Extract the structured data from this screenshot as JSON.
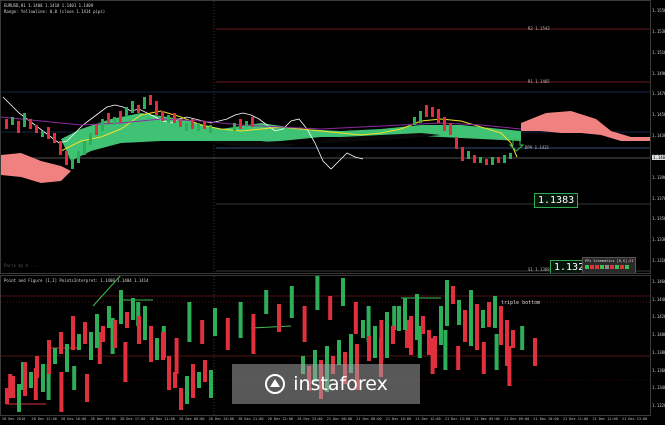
{
  "main": {
    "title": "EURUSD,H1 1.1408 1.1418 1.1401 1.1409",
    "subtitle": "Range: Yellowline: 0.0 (close 1.1414 pips)",
    "pivot_labels": {
      "r2": "R2 1.1543",
      "r1": "R1 1.1465",
      "pp": "DPV 1.1421",
      "s1": "S1 1.1368"
    },
    "price_box_mid": "1.1383",
    "price_box_low": "1.132",
    "current_price": "1.1407",
    "copyright": "Paris by © ...",
    "axis_labels": [
      "1.1550",
      "1.1530",
      "1.1510",
      "1.1490",
      "1.1470",
      "1.1450",
      "1.1430",
      "1.1410",
      "1.1390",
      "1.1370",
      "1.1350",
      "1.1330",
      "1.1310"
    ]
  },
  "ipivot": {
    "header": "PPz Schematics [R,S],S1",
    "cells": [
      "green",
      "red",
      "red",
      "green",
      "gray",
      "red",
      "green",
      "red",
      "green"
    ]
  },
  "sub": {
    "title": "Point and Figure [I,I] PointsInterpret: 1.1408 1.1404 1.1414",
    "annotation": "triple bottom",
    "axis_labels": [
      "1.1460",
      "1.1440",
      "1.1420",
      "1.1400",
      "1.1380",
      "1.1360",
      "1.1340",
      "1.1320"
    ]
  },
  "time_labels": [
    "28 Dec 2018",
    "28 Dec 12:00",
    "28 Dec 16:00",
    "28 Dec 19:00",
    "28 Dec 17:00",
    "28 Dec 21:00",
    "28 Dec 08:00",
    "28 Dec 20:00",
    "28 Dec 21:00",
    "28 Dec 22:00",
    "28 Dec 23:00",
    "21 Dec 00:00",
    "21 Dec 08:00",
    "21 Dec 16:00",
    "21 Dec 12:00",
    "21 Dec 13:00",
    "21 Dec 05:00",
    "21 Dec 09:00",
    "21 Dec 10:00",
    "21 Dec 11:00",
    "21 Dec 12:00",
    "21 Dec 13:00"
  ],
  "watermark": "instaforex",
  "colors": {
    "bull": "#2fae5a",
    "bear": "#e0303e",
    "cloud_bull": "#3cbf72",
    "cloud_bear": "#f47f7f",
    "yellow": "#f2e02a",
    "purple": "#8a2b9e"
  },
  "icons": [
    "candle-chart-icon",
    "point-figure-icon",
    "instaforex-logo-icon"
  ]
}
